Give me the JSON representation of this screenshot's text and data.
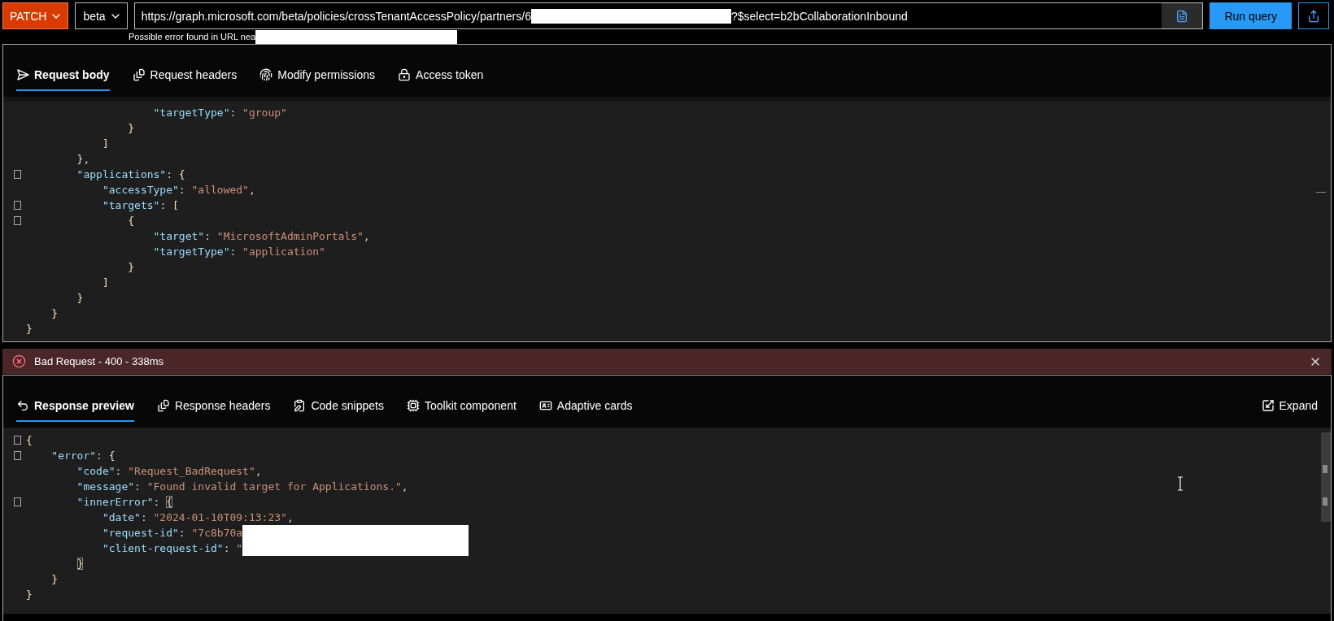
{
  "method": {
    "label": "PATCH"
  },
  "version": {
    "label": "beta"
  },
  "url": {
    "prefix": "https://graph.microsoft.com/beta/policies/crossTenantAccessPolicy/partners/6",
    "redacted": true,
    "suffix": "?$select=b2bCollaborationInbound"
  },
  "run_button": "Run query",
  "url_hint": {
    "text": "Possible error found in URL nea",
    "redacted": true
  },
  "request_tabs": [
    {
      "label": "Request body",
      "selected": true
    },
    {
      "label": "Request headers",
      "selected": false
    },
    {
      "label": "Modify permissions",
      "selected": false
    },
    {
      "label": "Access token",
      "selected": false
    }
  ],
  "request_body": {
    "lines": [
      {
        "fold": false,
        "tokens": [
          {
            "kind": "key",
            "text": "                    \"targetType\""
          },
          {
            "kind": "punct",
            "text": ": "
          },
          {
            "kind": "string",
            "text": "\"group\""
          }
        ]
      },
      {
        "fold": false,
        "tokens": [
          {
            "kind": "bracket",
            "text": "                }"
          }
        ]
      },
      {
        "fold": false,
        "tokens": [
          {
            "kind": "bracket",
            "text": "            ]"
          }
        ]
      },
      {
        "fold": false,
        "tokens": [
          {
            "kind": "bracket",
            "text": "        }"
          },
          {
            "kind": "punct",
            "text": ","
          }
        ]
      },
      {
        "fold": true,
        "tokens": [
          {
            "kind": "key",
            "text": "        \"applications\""
          },
          {
            "kind": "punct",
            "text": ": "
          },
          {
            "kind": "bracket",
            "text": "{"
          }
        ]
      },
      {
        "fold": false,
        "tokens": [
          {
            "kind": "key",
            "text": "            \"accessType\""
          },
          {
            "kind": "punct",
            "text": ": "
          },
          {
            "kind": "string",
            "text": "\"allowed\""
          },
          {
            "kind": "punct",
            "text": ","
          }
        ]
      },
      {
        "fold": true,
        "tokens": [
          {
            "kind": "key",
            "text": "            \"targets\""
          },
          {
            "kind": "punct",
            "text": ": "
          },
          {
            "kind": "bracket",
            "text": "["
          }
        ]
      },
      {
        "fold": true,
        "tokens": [
          {
            "kind": "bracket",
            "text": "                {"
          }
        ]
      },
      {
        "fold": false,
        "tokens": [
          {
            "kind": "key",
            "text": "                    \"target\""
          },
          {
            "kind": "punct",
            "text": ": "
          },
          {
            "kind": "string",
            "text": "\"MicrosoftAdminPortals\""
          },
          {
            "kind": "punct",
            "text": ","
          }
        ]
      },
      {
        "fold": false,
        "tokens": [
          {
            "kind": "key",
            "text": "                    \"targetType\""
          },
          {
            "kind": "punct",
            "text": ": "
          },
          {
            "kind": "string",
            "text": "\"application\""
          }
        ]
      },
      {
        "fold": false,
        "tokens": [
          {
            "kind": "bracket",
            "text": "                }"
          }
        ]
      },
      {
        "fold": false,
        "tokens": [
          {
            "kind": "bracket",
            "text": "            ]"
          }
        ]
      },
      {
        "fold": false,
        "tokens": [
          {
            "kind": "bracket",
            "text": "        }"
          }
        ]
      },
      {
        "fold": false,
        "tokens": [
          {
            "kind": "bracket",
            "text": "    }"
          }
        ]
      },
      {
        "fold": false,
        "tokens": [
          {
            "kind": "bracket",
            "text": "}"
          }
        ]
      }
    ]
  },
  "status": {
    "text": "Bad Request - 400 - 338ms",
    "kind": "error"
  },
  "response_tabs": [
    {
      "label": "Response preview",
      "selected": true
    },
    {
      "label": "Response headers",
      "selected": false
    },
    {
      "label": "Code snippets",
      "selected": false
    },
    {
      "label": "Toolkit component",
      "selected": false
    },
    {
      "label": "Adaptive cards",
      "selected": false
    }
  ],
  "expand_button": "Expand",
  "response_preview": {
    "lines": [
      {
        "fold": true,
        "tokens": [
          {
            "kind": "bracket",
            "text": "{"
          }
        ]
      },
      {
        "fold": true,
        "tokens": [
          {
            "kind": "key",
            "text": "    \"error\""
          },
          {
            "kind": "punct",
            "text": ": "
          },
          {
            "kind": "bracket",
            "text": "{"
          }
        ]
      },
      {
        "fold": false,
        "tokens": [
          {
            "kind": "key",
            "text": "        \"code\""
          },
          {
            "kind": "punct",
            "text": ": "
          },
          {
            "kind": "string",
            "text": "\"Request_BadRequest\""
          },
          {
            "kind": "punct",
            "text": ","
          }
        ]
      },
      {
        "fold": false,
        "tokens": [
          {
            "kind": "key",
            "text": "        \"message\""
          },
          {
            "kind": "punct",
            "text": ": "
          },
          {
            "kind": "string",
            "text": "\"Found invalid target for Applications.\""
          },
          {
            "kind": "punct",
            "text": ","
          }
        ]
      },
      {
        "fold": true,
        "tokens": [
          {
            "kind": "key",
            "text": "        \"innerError\""
          },
          {
            "kind": "punct",
            "text": ": "
          },
          {
            "kind": "match",
            "text": "{"
          }
        ]
      },
      {
        "fold": false,
        "tokens": [
          {
            "kind": "key",
            "text": "            \"date\""
          },
          {
            "kind": "punct",
            "text": ": "
          },
          {
            "kind": "string",
            "text": "\"2024-01-10T09:13:23\""
          },
          {
            "kind": "punct",
            "text": ","
          }
        ]
      },
      {
        "fold": false,
        "redacted": true,
        "tokens": [
          {
            "kind": "key",
            "text": "            \"request-id\""
          },
          {
            "kind": "punct",
            "text": ": "
          },
          {
            "kind": "string",
            "text": "\"7c8b70a"
          }
        ]
      },
      {
        "fold": false,
        "redacted": true,
        "tokens": [
          {
            "kind": "key",
            "text": "            \"client-request-id\""
          },
          {
            "kind": "punct",
            "text": ": "
          },
          {
            "kind": "string",
            "text": "\""
          }
        ]
      },
      {
        "fold": false,
        "tokens": [
          {
            "kind": "match",
            "text": "        }"
          }
        ]
      },
      {
        "fold": false,
        "tokens": [
          {
            "kind": "bracket",
            "text": "    }"
          }
        ]
      },
      {
        "fold": false,
        "tokens": [
          {
            "kind": "bracket",
            "text": "}"
          }
        ]
      }
    ]
  }
}
